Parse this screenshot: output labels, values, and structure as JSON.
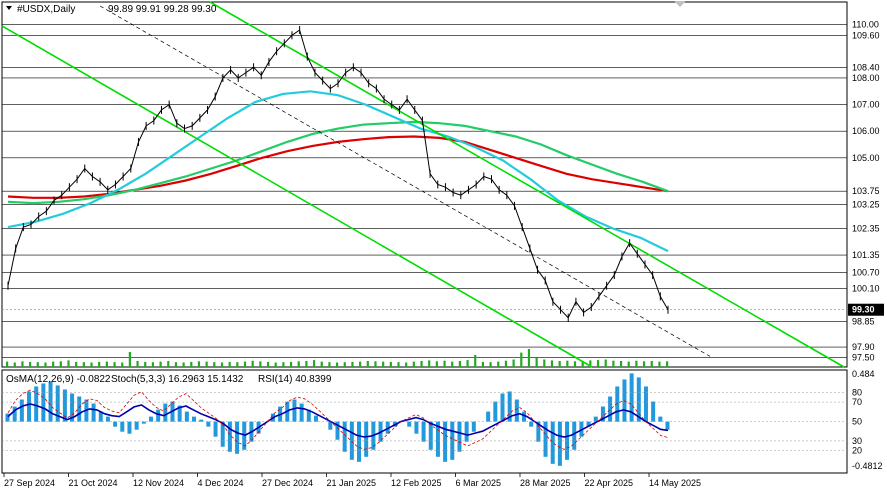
{
  "header": {
    "symbol": "#USDX,Daily",
    "ohlc": "99.89 99.91 99.28 99.30"
  },
  "indicator_header": {
    "osma": "OsMA(12,26,9) -0.0822",
    "stoch": "Stoch(5,3,3) 16.2963 15.1432",
    "rsi": "RSI(14) 40.8399"
  },
  "colors": {
    "price_line": "#000000",
    "trend_green": "#00dd00",
    "ma_red": "#dd0000",
    "ma_green": "#22cc66",
    "ma_cyan": "#22ccdd",
    "volume": "#22aa22",
    "osma_bar": "#2299dd",
    "rsi_line": "#0000aa",
    "stoch_main": "#dd0000",
    "stoch_signal": "#000077",
    "grid": "#000000"
  },
  "chart_data": [
    {
      "type": "line",
      "panel": "main",
      "x_labels": [
        "27 Sep 2024",
        "21 Oct 2024",
        "12 Nov 2024",
        "4 Dec 2024",
        "27 Dec 2024",
        "21 Jan 2025",
        "12 Feb 2025",
        "6 Mar 2025",
        "28 Mar 2025",
        "22 Apr 2025",
        "14 May 2025"
      ],
      "y_levels": [
        110.0,
        109.6,
        108.4,
        108.0,
        107.0,
        106.0,
        105.0,
        103.75,
        103.25,
        102.35,
        101.35,
        100.7,
        100.1,
        98.85,
        97.9,
        97.5
      ],
      "y_ticks": [
        "110.00",
        "109.60",
        "108.40",
        "108.00",
        "107.00",
        "106.00",
        "105.00",
        "103.75",
        "103.25",
        "102.35",
        "101.35",
        "100.70",
        "100.10",
        "98.85",
        "97.90",
        "97.50"
      ],
      "current_price": 99.3,
      "current_price_label": "99.30",
      "ylim": [
        97.15,
        110.85
      ],
      "series": [
        {
          "values": [
            100.2,
            101.6,
            102.4,
            102.5,
            102.8,
            103.0,
            103.4,
            103.6,
            103.9,
            104.2,
            104.6,
            104.3,
            104.1,
            103.8,
            104.0,
            104.3,
            104.6,
            105.6,
            106.2,
            106.4,
            106.8,
            107.0,
            106.3,
            106.1,
            106.2,
            106.5,
            106.8,
            107.3,
            108.0,
            108.3,
            108.0,
            108.2,
            108.4,
            108.1,
            108.6,
            109.0,
            109.3,
            109.6,
            109.8,
            108.8,
            108.2,
            107.9,
            107.6,
            107.8,
            108.2,
            108.4,
            108.2,
            107.8,
            107.6,
            107.2,
            107.0,
            106.8,
            107.2,
            106.8,
            106.4,
            104.4,
            104.0,
            103.9,
            103.7,
            103.6,
            103.8,
            104.0,
            104.3,
            104.2,
            103.8,
            103.6,
            103.2,
            102.4,
            101.6,
            100.8,
            100.4,
            99.6,
            99.3,
            99.0,
            99.6,
            99.2,
            99.4,
            99.8,
            100.2,
            100.6,
            101.3,
            101.8,
            101.4,
            101.0,
            100.6,
            99.8,
            99.3
          ],
          "ylim": [
            97.15,
            110.85
          ]
        },
        {
          "values": [
            103.55,
            103.5,
            103.5,
            103.55,
            103.65,
            103.8,
            103.95,
            104.15,
            104.4,
            104.7,
            105.0,
            105.25,
            105.45,
            105.6,
            105.7,
            105.78,
            105.8,
            105.75,
            105.6,
            105.3,
            105.0,
            104.7,
            104.4,
            104.2,
            104.05,
            103.9,
            103.75
          ],
          "ylim": [
            97.15,
            110.85
          ]
        },
        {
          "values": [
            103.35,
            103.3,
            103.35,
            103.45,
            103.6,
            103.8,
            104.05,
            104.3,
            104.6,
            104.9,
            105.25,
            105.6,
            105.9,
            106.1,
            106.25,
            106.3,
            106.35,
            106.3,
            106.2,
            106.0,
            105.8,
            105.5,
            105.1,
            104.75,
            104.4,
            104.1,
            103.75
          ],
          "ylim": [
            97.15,
            110.85
          ]
        },
        {
          "values": [
            102.4,
            102.6,
            102.9,
            103.3,
            103.8,
            104.4,
            105.1,
            105.8,
            106.5,
            107.1,
            107.4,
            107.5,
            107.35,
            107.0,
            106.55,
            106.1,
            105.8,
            105.4,
            104.9,
            104.2,
            103.4,
            102.8,
            102.35,
            102.0,
            101.5
          ],
          "ylim": [
            97.15,
            110.85
          ]
        }
      ],
      "volume": [
        0.18,
        0.15,
        0.19,
        0.17,
        0.16,
        0.15,
        0.18,
        0.19,
        0.22,
        0.17,
        0.16,
        0.15,
        0.17,
        0.18,
        0.16,
        0.15,
        0.5,
        0.2,
        0.17,
        0.16,
        0.18,
        0.2,
        0.16,
        0.15,
        0.17,
        0.19,
        0.18,
        0.16,
        0.15,
        0.17,
        0.16,
        0.18,
        0.21,
        0.19,
        0.17,
        0.15,
        0.16,
        0.17,
        0.19,
        0.2,
        0.23,
        0.18,
        0.16,
        0.15,
        0.16,
        0.17,
        0.18,
        0.2,
        0.19,
        0.18,
        0.17,
        0.16,
        0.15,
        0.18,
        0.2,
        0.22,
        0.19,
        0.21,
        0.18,
        0.2,
        0.23,
        0.4,
        0.17,
        0.16,
        0.18,
        0.21,
        0.25,
        0.48,
        0.6,
        0.3,
        0.25,
        0.22,
        0.2,
        0.21,
        0.19,
        0.2,
        0.22,
        0.23,
        0.25,
        0.21,
        0.2,
        0.18,
        0.21,
        0.19,
        0.2,
        0.18,
        0.19
      ]
    },
    {
      "type": "bar",
      "panel": "oscillator",
      "y_ticks": [
        "0.484",
        "80",
        "70",
        "50",
        "30",
        "20",
        "-0.4812"
      ],
      "osma_range": [
        -0.4812,
        0.484
      ],
      "osma": [
        0.08,
        0.15,
        0.22,
        0.3,
        0.35,
        0.38,
        0.4,
        0.36,
        0.32,
        0.28,
        0.25,
        0.22,
        0.18,
        0.1,
        0.05,
        -0.05,
        -0.1,
        -0.12,
        -0.08,
        -0.02,
        0.05,
        0.12,
        0.18,
        0.2,
        0.16,
        0.1,
        0.05,
        0.02,
        -0.05,
        -0.15,
        -0.25,
        -0.3,
        -0.32,
        -0.28,
        -0.2,
        -0.12,
        0.0,
        0.08,
        0.15,
        0.2,
        0.22,
        0.18,
        0.12,
        0.06,
        0.0,
        -0.08,
        -0.18,
        -0.3,
        -0.38,
        -0.4,
        -0.35,
        -0.28,
        -0.2,
        -0.12,
        -0.05,
        0.0,
        -0.05,
        -0.12,
        -0.2,
        -0.28,
        -0.35,
        -0.4,
        -0.38,
        -0.3,
        -0.2,
        -0.1,
        0.0,
        0.1,
        0.2,
        0.28,
        0.3,
        0.22,
        0.1,
        -0.05,
        -0.2,
        -0.35,
        -0.42,
        -0.44,
        -0.38,
        -0.28,
        -0.15,
        -0.05,
        0.05,
        0.15,
        0.25,
        0.35,
        0.42,
        0.48,
        0.44,
        0.35,
        0.2,
        0.05,
        -0.08
      ],
      "rsi": [
        55,
        62,
        66,
        68,
        66,
        63,
        58,
        55,
        52,
        55,
        60,
        63,
        62,
        58,
        56,
        55,
        60,
        65,
        67,
        62,
        58,
        56,
        60,
        64,
        66,
        62,
        58,
        55,
        52,
        48,
        42,
        38,
        36,
        40,
        45,
        50,
        55,
        58,
        62,
        64,
        63,
        60,
        56,
        52,
        48,
        44,
        40,
        36,
        34,
        35,
        38,
        42,
        46,
        50,
        52,
        54,
        52,
        48,
        45,
        42,
        40,
        38,
        36,
        38,
        40,
        44,
        48,
        52,
        56,
        58,
        55,
        50,
        45,
        40,
        36,
        34,
        36,
        40,
        44,
        48,
        52,
        56,
        60,
        62,
        60,
        55,
        50,
        46,
        42,
        40.8
      ]
    }
  ]
}
